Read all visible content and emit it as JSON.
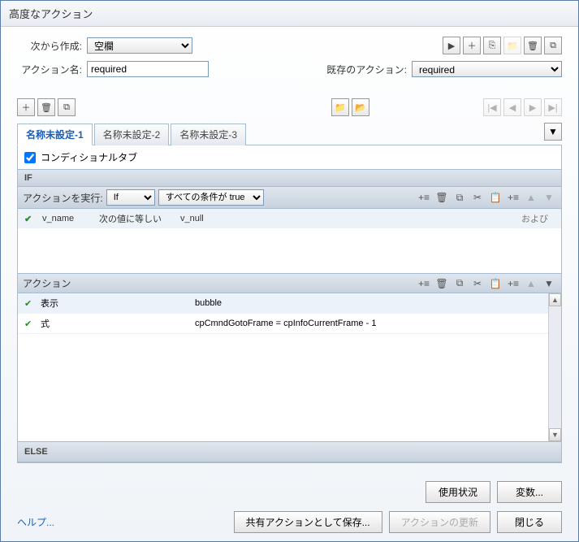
{
  "window": {
    "title": "高度なアクション"
  },
  "create": {
    "label": "次から作成:",
    "value": "空欄"
  },
  "action_name": {
    "label": "アクション名:",
    "value": "required"
  },
  "existing": {
    "label": "既存のアクション:",
    "value": "required"
  },
  "tabs": [
    {
      "label": "名称未設定-1",
      "active": true
    },
    {
      "label": "名称未設定-2",
      "active": false
    },
    {
      "label": "名称未設定-3",
      "active": false
    }
  ],
  "conditional_tab": {
    "label": "コンディショナルタブ",
    "checked": true
  },
  "if_section": {
    "header": "IF",
    "exec_label": "アクションを実行:",
    "exec_value": "If",
    "cond_value": "すべての条件が true",
    "rows": [
      {
        "var": "v_name",
        "op": "次の値に等しい",
        "val": "v_null",
        "andor": "および"
      }
    ]
  },
  "action_section": {
    "header": "アクション",
    "rows": [
      {
        "name": "表示",
        "value": "bubble",
        "alt": true
      },
      {
        "name": "式",
        "value": "cpCmndGotoFrame   =   cpInfoCurrentFrame   -   1",
        "alt": false
      }
    ]
  },
  "else_section": {
    "header": "ELSE"
  },
  "footer": {
    "usage": "使用状況",
    "variables": "変数...",
    "help": "ヘルプ...",
    "save_shared": "共有アクションとして保存...",
    "update": "アクションの更新",
    "close": "閉じる"
  },
  "icons": {
    "play": "▶",
    "plus": "＋",
    "trash": "🗑",
    "copy": "⧉",
    "folder1": "📁",
    "folder2": "📂",
    "first": "|◀",
    "prev": "◀",
    "next": "▶",
    "last": "▶|",
    "add_row": "+≡",
    "del": "🗑",
    "dup": "⧉",
    "cut": "✂",
    "paste": "📋",
    "insert": "+≡",
    "up": "▲",
    "down": "▼",
    "dupaction": "⎘"
  }
}
